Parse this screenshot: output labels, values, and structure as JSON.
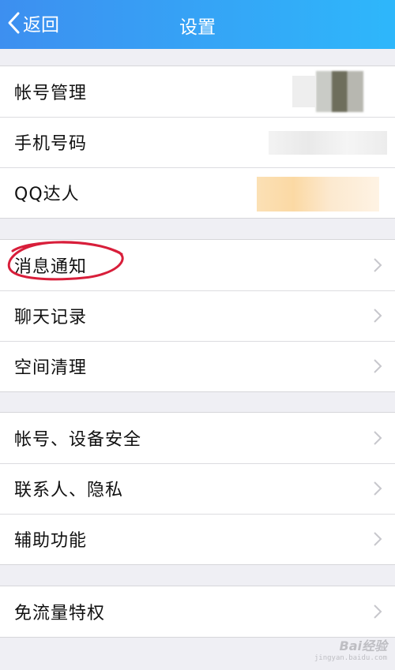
{
  "navbar": {
    "back_label": "返回",
    "title": "设置"
  },
  "groups": [
    {
      "items": [
        {
          "label": "帐号管理",
          "chevron": false
        },
        {
          "label": "手机号码",
          "chevron": false
        },
        {
          "label": "QQ达人",
          "chevron": false
        }
      ]
    },
    {
      "items": [
        {
          "label": "消息通知",
          "chevron": true
        },
        {
          "label": "聊天记录",
          "chevron": true
        },
        {
          "label": "空间清理",
          "chevron": true
        }
      ]
    },
    {
      "items": [
        {
          "label": "帐号、设备安全",
          "chevron": true
        },
        {
          "label": "联系人、隐私",
          "chevron": true
        },
        {
          "label": "辅助功能",
          "chevron": true
        }
      ]
    },
    {
      "items": [
        {
          "label": "免流量特权",
          "chevron": true
        }
      ]
    }
  ],
  "watermark": {
    "main": "Bai经验",
    "sub": "jingyan.baidu.com"
  },
  "colors": {
    "nav_start": "#3d8ff0",
    "nav_end": "#2eb7fb",
    "background": "#efeff4",
    "annotation": "#d81e3a"
  }
}
